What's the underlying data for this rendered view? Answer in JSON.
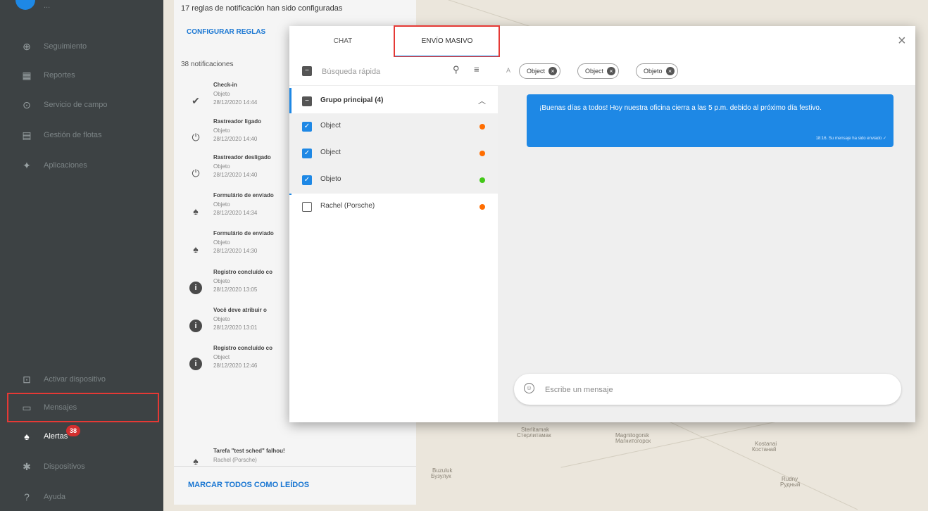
{
  "sidebar": {
    "items": [
      {
        "label": "Seguimiento",
        "icon": "globe-icon"
      },
      {
        "label": "Reportes",
        "icon": "report-icon"
      },
      {
        "label": "Servicio de campo",
        "icon": "location-pin-icon"
      },
      {
        "label": "Gestión de flotas",
        "icon": "car-icon"
      },
      {
        "label": "Aplicaciones",
        "icon": "puzzle-icon"
      }
    ],
    "bottom_items": [
      {
        "label": "Activar dispositivo",
        "icon": "device-add-icon"
      },
      {
        "label": "Mensajes",
        "icon": "message-icon"
      },
      {
        "label": "Alertas",
        "icon": "bell-icon",
        "badge": "38"
      },
      {
        "label": "Dispositivos",
        "icon": "gear-icon"
      },
      {
        "label": "Ayuda",
        "icon": "help-icon"
      }
    ]
  },
  "notifications": {
    "header": "17 reglas de notificación han sido configuradas",
    "configure": "CONFIGURAR REGLAS",
    "count": "38 notificaciones",
    "items": [
      {
        "title": "Check-in",
        "subject": "Objeto",
        "date": "28/12/2020 14:44",
        "icon": "checkin-icon"
      },
      {
        "title": "Rastreador ligado",
        "subject": "Objeto",
        "date": "28/12/2020 14:40",
        "icon": "power-icon"
      },
      {
        "title": "Rastreador desligado",
        "subject": "Objeto",
        "date": "28/12/2020 14:40",
        "icon": "power-off-icon"
      },
      {
        "title": "Formulário de enviado",
        "subject": "Objeto",
        "date": "28/12/2020 14:34",
        "icon": "bell-icon"
      },
      {
        "title": "Formulário de enviado",
        "subject": "Objeto",
        "date": "28/12/2020 14:30",
        "icon": "bell-icon"
      },
      {
        "title": "Registro concluído co",
        "subject": "Objeto",
        "date": "28/12/2020 13:05",
        "icon": "info-icon"
      },
      {
        "title": "Você deve atribuir o",
        "subject": "Objeto",
        "date": "28/12/2020 13:01",
        "icon": "info-icon"
      },
      {
        "title": "Registro concluído co",
        "subject": "Object",
        "date": "28/12/2020 12:46",
        "icon": "info-icon"
      },
      {
        "title": "Tarefa \"test sched\" falhou!",
        "subject": "Rachel (Porsche)",
        "date": "",
        "icon": "bell-icon"
      }
    ],
    "mark_all": "MARCAR TODOS COMO LEÍDOS"
  },
  "modal": {
    "tabs": [
      "CHAT",
      "ENVÍO MASIVO"
    ],
    "active_tab": "ENVÍO MASIVO",
    "search_placeholder": "Búsqueda rápida",
    "group": {
      "label": "Grupo principal (4)"
    },
    "objects": [
      {
        "label": "Object",
        "checked": true,
        "status_color": "#ff6d00"
      },
      {
        "label": "Object",
        "checked": true,
        "status_color": "#ff6d00"
      },
      {
        "label": "Objeto",
        "checked": true,
        "status_color": "#43c818"
      },
      {
        "label": "Rachel (Porsche)",
        "checked": false,
        "status_color": "#ff6d00"
      }
    ],
    "recipients_prefix": "A",
    "recipients": [
      "Object",
      "Object",
      "Objeto"
    ],
    "message": {
      "text": "¡Buenas días a todos! Hoy nuestra oficina cierra a las 5 p.m. debido al próximo día festivo.",
      "meta": "18:16. Su mensaje ha sido enviado ✓"
    },
    "composer_placeholder": "Escribe un mensaje"
  },
  "map_labels": [
    "Sterlitamak",
    "Стерлитамак",
    "Magnitogorsk",
    "Магнитогорск",
    "Kostanai",
    "Костанай",
    "Buzuluk",
    "Бузулук",
    "Rudny",
    "Рудный"
  ],
  "colors": {
    "accent": "#1e88e5",
    "highlight": "#e53935",
    "sidebar": "#3d4244"
  }
}
